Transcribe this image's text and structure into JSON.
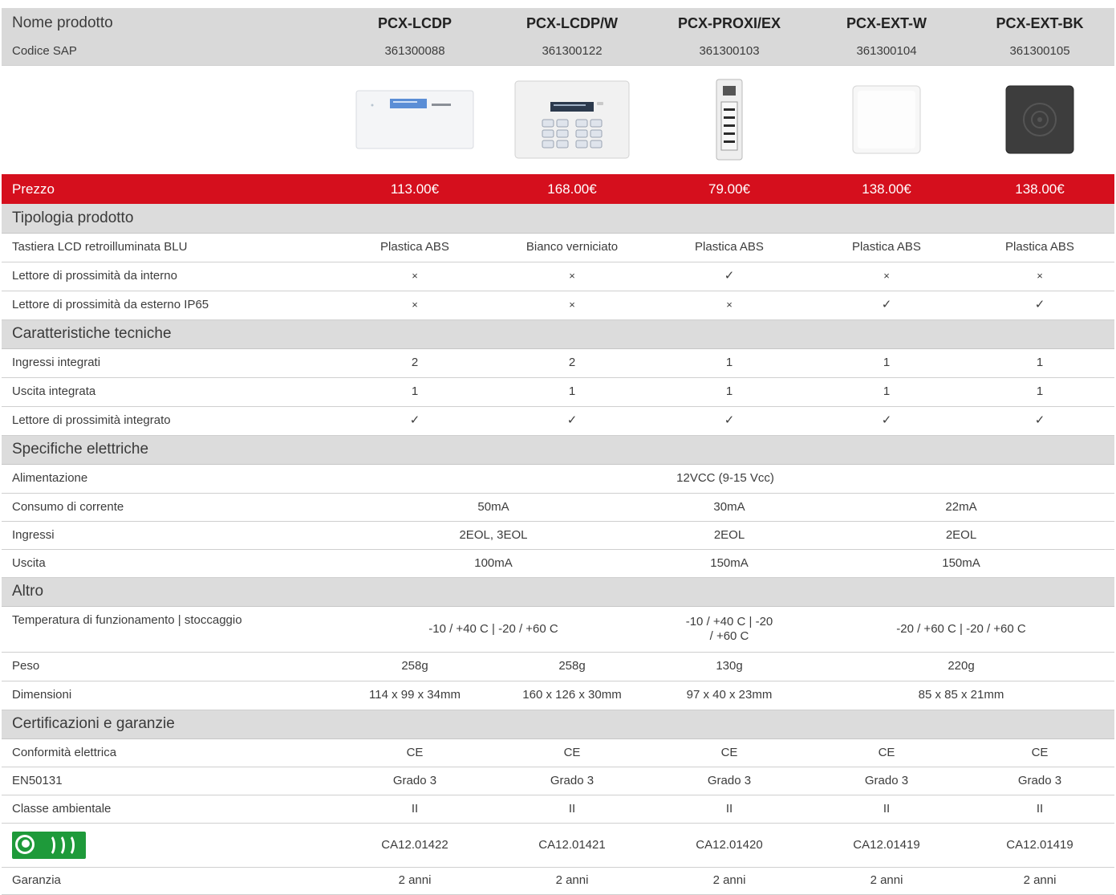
{
  "columns": [
    "PCX-LCDP",
    "PCX-LCDP/W",
    "PCX-PROXI/EX",
    "PCX-EXT-W",
    "PCX-EXT-BK"
  ],
  "header": {
    "label": "Nome prodotto"
  },
  "sap": {
    "label": "Codice SAP",
    "values": [
      "361300088",
      "361300122",
      "361300103",
      "361300104",
      "361300105"
    ]
  },
  "price": {
    "label": "Prezzo",
    "values": [
      "113.00€",
      "168.00€",
      "79.00€",
      "138.00€",
      "138.00€"
    ]
  },
  "sections": {
    "tipologia": "Tipologia prodotto",
    "tecniche": "Caratteristiche tecniche",
    "elettriche": "Specifiche elettriche",
    "altro": "Altro",
    "certificazioni": "Certificazioni e garanzie"
  },
  "rows": {
    "tastiera": {
      "label": "Tastiera LCD retroilluminata BLU",
      "values": [
        "Plastica ABS",
        "Bianco verniciato",
        "Plastica ABS",
        "Plastica ABS",
        "Plastica ABS"
      ]
    },
    "lettore_interno": {
      "label": "Lettore di prossimità da interno",
      "values": [
        "×",
        "×",
        "✓",
        "×",
        "×"
      ]
    },
    "lettore_esterno": {
      "label": "Lettore di prossimità da esterno IP65",
      "values": [
        "×",
        "×",
        "×",
        "✓",
        "✓"
      ]
    },
    "ingressi_integrati": {
      "label": "Ingressi integrati",
      "values": [
        "2",
        "2",
        "1",
        "1",
        "1"
      ]
    },
    "uscita_integrata": {
      "label": "Uscita integrata",
      "values": [
        "1",
        "1",
        "1",
        "1",
        "1"
      ]
    },
    "lettore_integrato": {
      "label": "Lettore di prossimità integrato",
      "values": [
        "✓",
        "✓",
        "✓",
        "✓",
        "✓"
      ]
    },
    "alimentazione": {
      "label": "Alimentazione",
      "value": "12VCC (9-15 Vcc)"
    },
    "consumo": {
      "label": "Consumo di corrente",
      "values": [
        "50mA",
        "30mA",
        "22mA"
      ]
    },
    "ingressi": {
      "label": "Ingressi",
      "values": [
        "2EOL, 3EOL",
        "2EOL",
        "2EOL"
      ]
    },
    "uscita": {
      "label": "Uscita",
      "values": [
        "100mA",
        "150mA",
        "150mA"
      ]
    },
    "temperatura": {
      "label": "Temperatura di funzionamento | stoccaggio",
      "values": [
        "-10 / +40 C | -20 / +60 C",
        "-10 / +40 C | -20 / +60 C",
        "-20 / +60 C | -20 / +60 C"
      ]
    },
    "peso": {
      "label": "Peso",
      "values": [
        "258g",
        "258g",
        "130g",
        "220g"
      ]
    },
    "dimensioni": {
      "label": "Dimensioni",
      "values": [
        "114 x 99 x 34mm",
        "160 x 126 x 30mm",
        "97 x 40 x 23mm",
        "85 x 85 x 21mm"
      ]
    },
    "conformita": {
      "label": "Conformità elettrica",
      "values": [
        "CE",
        "CE",
        "CE",
        "CE",
        "CE"
      ]
    },
    "en50131": {
      "label": "EN50131",
      "values": [
        "Grado 3",
        "Grado 3",
        "Grado 3",
        "Grado 3",
        "Grado 3"
      ]
    },
    "classe": {
      "label": "Classe ambientale",
      "values": [
        "II",
        "II",
        "II",
        "II",
        "II"
      ]
    },
    "imq": {
      "values": [
        "CA12.01422",
        "CA12.01421",
        "CA12.01420",
        "CA12.01419",
        "CA12.01419"
      ]
    },
    "garanzia": {
      "label": "Garanzia",
      "values": [
        "2 anni",
        "2 anni",
        "2 anni",
        "2 anni",
        "2 anni"
      ]
    }
  },
  "colors": {
    "price_bg": "#d50f1d",
    "grade": "#d4232b",
    "section_bg": "#dcdcdc",
    "logo": "#1e9a3a"
  }
}
